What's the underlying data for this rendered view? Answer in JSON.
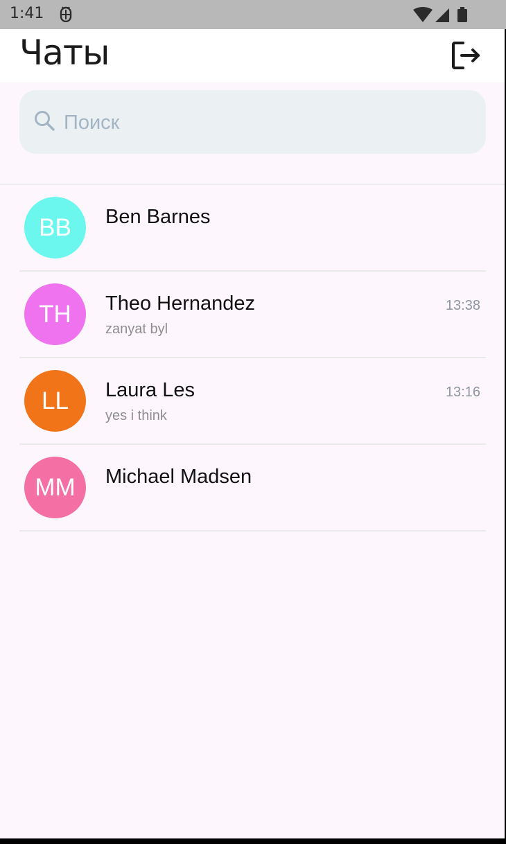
{
  "status_bar": {
    "time": "1:41",
    "icons": [
      "android-debug-icon",
      "wifi-icon",
      "signal-icon",
      "battery-icon"
    ]
  },
  "header": {
    "title": "Чаты",
    "logout_icon": "logout-icon"
  },
  "search": {
    "placeholder": "Поиск",
    "value": "",
    "icon": "search-icon"
  },
  "chats": [
    {
      "initials": "BB",
      "name": "Ben Barnes",
      "preview": "",
      "time": "",
      "avatar_color": "#6cf7ee"
    },
    {
      "initials": "TH",
      "name": "Theo Hernandez",
      "preview": "zanyat byl",
      "time": "13:38",
      "avatar_color": "#ef72ee"
    },
    {
      "initials": "LL",
      "name": "Laura Les",
      "preview": "yes i think",
      "time": "13:16",
      "avatar_color": "#f27419"
    },
    {
      "initials": "MM",
      "name": "Michael Madsen",
      "preview": "",
      "time": "",
      "avatar_color": "#f36fa4"
    }
  ],
  "colors": {
    "background": "#fdf7fd",
    "status_bar": "#b8b8b8",
    "search_bg": "#ebf0f3",
    "search_placeholder": "#a3b5c5",
    "time_text": "#8d96a0"
  }
}
